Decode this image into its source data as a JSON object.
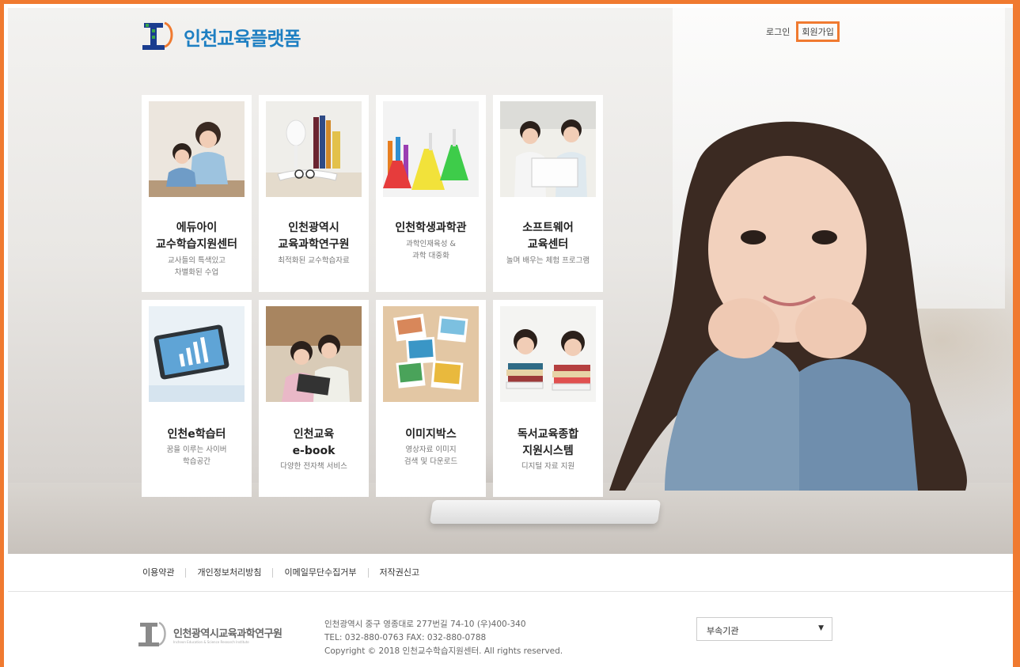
{
  "header": {
    "logo_text": "인천교육플랫폼",
    "login": "로그인",
    "signup": "회원가입"
  },
  "cards": [
    {
      "title1": "에듀아이",
      "title2": "교수학습지원센터",
      "sub1": "교사들의 특색있고",
      "sub2": "차별화된 수업"
    },
    {
      "title1": "인천광역시",
      "title2": "교육과학연구원",
      "sub1": "최적화된 교수학습자료",
      "sub2": ""
    },
    {
      "title1": "인천학생과학관",
      "title2": "",
      "sub1": "과학인재육성 &",
      "sub2": "과학 대중화"
    },
    {
      "title1": "소프트웨어",
      "title2": "교육센터",
      "sub1": "놀며 배우는 체험 프로그램",
      "sub2": ""
    },
    {
      "title1": "인천e학습터",
      "title2": "",
      "sub1": "꿈을 이루는 사이버",
      "sub2": "학습공간"
    },
    {
      "title1": "인천교육",
      "title2": "e-book",
      "sub1": "다양한 전자책 서비스",
      "sub2": ""
    },
    {
      "title1": "이미지박스",
      "title2": "",
      "sub1": "영상자료 이미지",
      "sub2": "검색 및 다운로드"
    },
    {
      "title1": "독서교육종합",
      "title2": "지원시스템",
      "sub1": "디지털 자료 지원",
      "sub2": ""
    }
  ],
  "footer": {
    "links": [
      "이용약관",
      "개인정보처리방침",
      "이메일무단수집거부",
      "저작권신고"
    ],
    "logo_text": "인천광역시교육과학연구원",
    "logo_en": "Incheon Education & Science Research Institute",
    "address": "인천광역시 중구 영종대로 277번길 74-10 (우)400-340",
    "tel": "TEL: 032-880-0763 FAX: 032-880-0788",
    "copyright": "Copyright © 2018 인천교수학습지원센터. All rights reserved.",
    "select_value": "부속기관"
  },
  "colors": {
    "accent": "#f07a30",
    "brand": "#1e7fc2"
  }
}
